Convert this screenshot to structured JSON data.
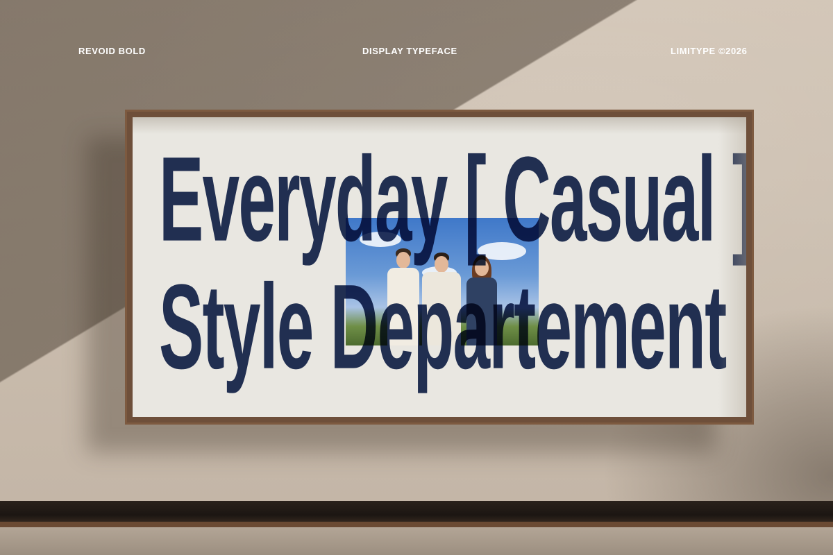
{
  "header": {
    "left_label": "REVOID BOLD",
    "center_label": "DISPLAY TYPEFACE",
    "right_label": "LIMITYPE ©2026"
  },
  "billboard": {
    "headline_line1": "Everyday [ Casual ]",
    "headline_line2": "Style Departement",
    "headline_color": "#1b2a55"
  }
}
